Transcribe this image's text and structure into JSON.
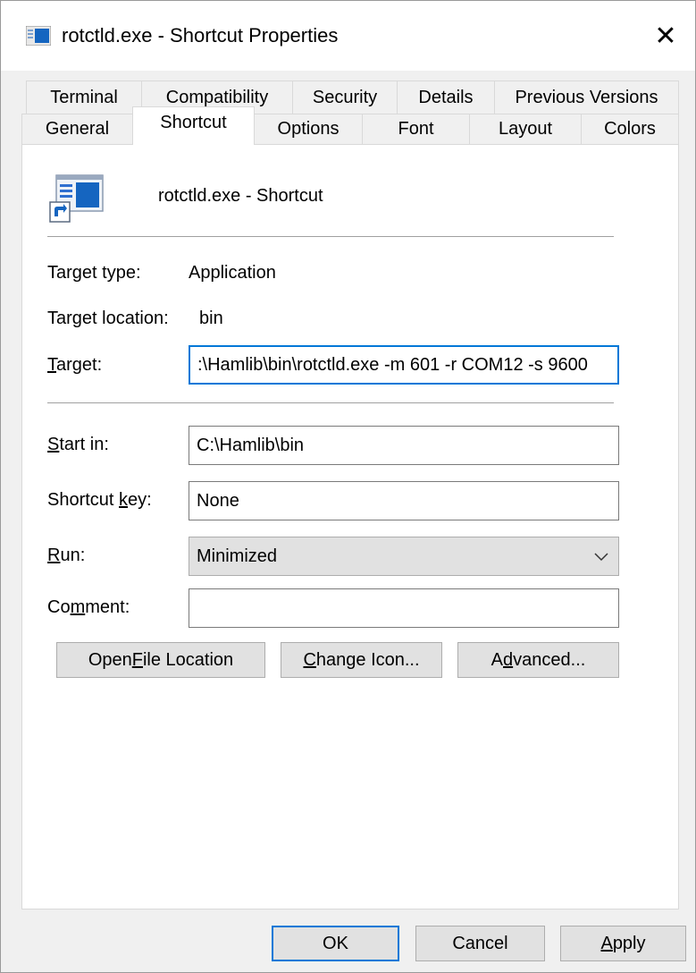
{
  "window": {
    "title": "rotctld.exe - Shortcut Properties",
    "close_glyph": "✕"
  },
  "tabs": {
    "row_back": [
      {
        "label": "Terminal"
      },
      {
        "label": "Compatibility"
      },
      {
        "label": "Security"
      },
      {
        "label": "Details"
      },
      {
        "label": "Previous Versions"
      }
    ],
    "row_front": [
      {
        "label": "General"
      },
      {
        "label": "Shortcut",
        "active": true
      },
      {
        "label": "Options"
      },
      {
        "label": "Font"
      },
      {
        "label": "Layout"
      },
      {
        "label": "Colors"
      }
    ]
  },
  "shortcut": {
    "name": "rotctld.exe - Shortcut",
    "icon": "application-shortcut-icon",
    "target_type_label": "Target type:",
    "target_type_value": "Application",
    "target_location_label": "Target location:",
    "target_location_value": "bin",
    "target_label_mnemonic": "T",
    "target_label_rest": "arget:",
    "target_value": ":\\Hamlib\\bin\\rotctld.exe -m 601 -r COM12 -s 9600",
    "start_in_label_mnemonic": "S",
    "start_in_label_rest": "tart in:",
    "start_in_value": "C:\\Hamlib\\bin",
    "shortcut_key_label_pre": "Shortcut ",
    "shortcut_key_label_mnemonic": "k",
    "shortcut_key_label_rest": "ey:",
    "shortcut_key_value": "None",
    "run_label_mnemonic": "R",
    "run_label_rest": "un:",
    "run_value": "Minimized",
    "comment_label_pre": "Co",
    "comment_label_mnemonic": "m",
    "comment_label_rest": "ment:",
    "comment_value": ""
  },
  "actions": {
    "open_file_location_pre": "Open ",
    "open_file_location_mnemonic": "F",
    "open_file_location_rest": "ile Location",
    "change_icon_mnemonic": "C",
    "change_icon_rest": "hange Icon...",
    "advanced_pre": "A",
    "advanced_mnemonic": "d",
    "advanced_rest": "vanced..."
  },
  "footer": {
    "ok": "OK",
    "cancel": "Cancel",
    "apply_mnemonic": "A",
    "apply_rest": "pply"
  },
  "colors": {
    "accent": "#0078d7",
    "panel": "#ffffff",
    "chrome": "#f0f0f0",
    "button": "#e1e1e1"
  }
}
